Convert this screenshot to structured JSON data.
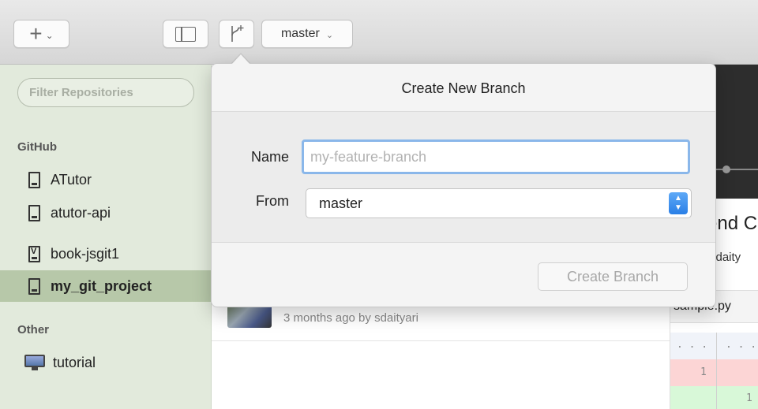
{
  "toolbar": {
    "add_glyph": "+",
    "add_chevron": "⌄",
    "branch_selector": "master",
    "branch_chevron": "⌄"
  },
  "sidebar": {
    "filter_placeholder": "Filter Repositories",
    "sections": [
      {
        "title": "GitHub",
        "repos": [
          {
            "label": "ATutor",
            "selected": false
          },
          {
            "label": "atutor-api",
            "selected": false
          },
          {
            "label": "book-jsgit1",
            "selected": false
          },
          {
            "label": "my_git_project",
            "selected": true
          }
        ]
      },
      {
        "title": "Other",
        "repos": [
          {
            "label": "tutorial",
            "selected": false
          }
        ]
      }
    ]
  },
  "history": {
    "commit_meta": "3 months ago by sdaityari"
  },
  "detail": {
    "title_fragment": "end C",
    "author_fragment": "sdaity",
    "file_fragment": "sample.py",
    "ctx_marker_left": ". . .",
    "ctx_marker_right": ". . .",
    "del_line_no": "1",
    "add_line_no": "1"
  },
  "popover": {
    "title": "Create New Branch",
    "name_label": "Name",
    "name_placeholder": "my-feature-branch",
    "name_value": "",
    "from_label": "From",
    "from_value": "master",
    "stepper_up": "▲",
    "stepper_down": "▼",
    "create_button": "Create Branch"
  },
  "colors": {
    "sidebar_bg": "#e2eadc",
    "selected_repo_bg": "#b7c8a9",
    "focus_ring": "#8ab7ea",
    "stepper_blue": "#2a7fe6"
  }
}
